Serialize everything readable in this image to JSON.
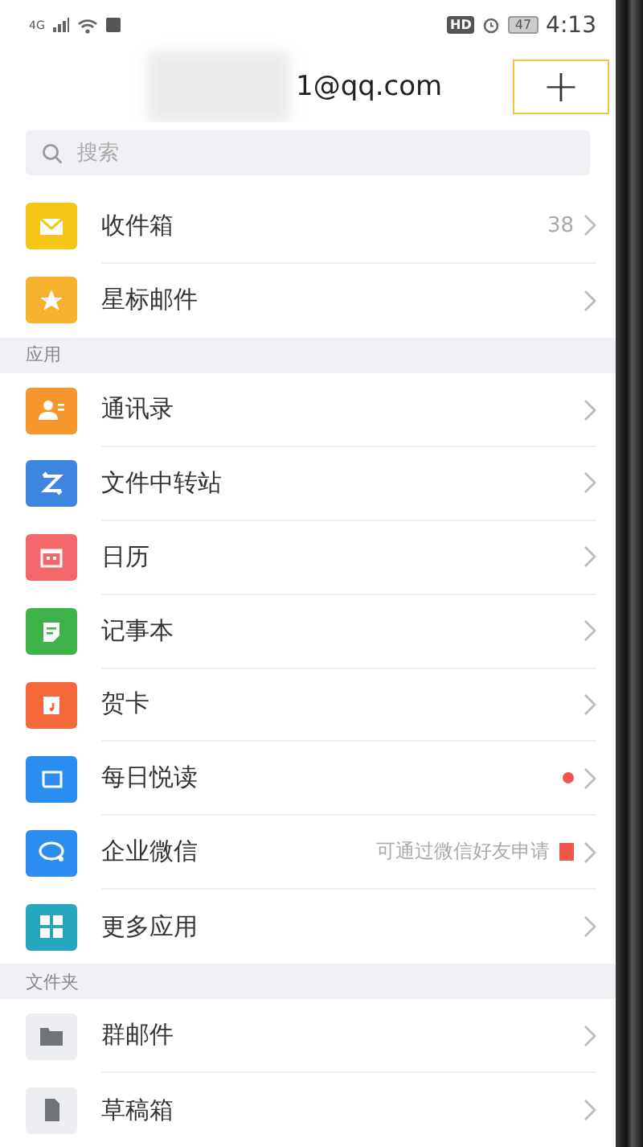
{
  "status_bar": {
    "network": "4G",
    "hd": "HD",
    "battery": "47",
    "time": "4:13"
  },
  "header": {
    "email": "1@qq.com",
    "add_button": "+",
    "highlighted": true
  },
  "search": {
    "placeholder": "搜索"
  },
  "sections": [
    {
      "items": [
        {
          "kind": "mail",
          "color": "#f5c518",
          "label": "收件箱",
          "count": "38"
        },
        {
          "kind": "star",
          "color": "#f8b12c",
          "label": "星标邮件"
        }
      ]
    },
    {
      "title": "应用",
      "items": [
        {
          "kind": "contacts",
          "color": "#f7962f",
          "label": "通讯录"
        },
        {
          "kind": "transfer",
          "color": "#3f86e0",
          "label": "文件中转站"
        },
        {
          "kind": "calendar",
          "color": "#f2676a",
          "label": "日历"
        },
        {
          "kind": "note",
          "color": "#3db34a",
          "label": "记事本"
        },
        {
          "kind": "card",
          "color": "#f4683a",
          "label": "贺卡"
        },
        {
          "kind": "reading",
          "color": "#2a8ef0",
          "label": "每日悦读",
          "dot": true
        },
        {
          "kind": "wework",
          "color": "#2d8cf0",
          "label": "企业微信",
          "hint": "可通过微信好友申请",
          "flag": true
        },
        {
          "kind": "apps",
          "color": "#25a7c0",
          "label": "更多应用"
        }
      ]
    },
    {
      "title": "文件夹",
      "items": [
        {
          "kind": "folder",
          "color": "#eceef2",
          "label": "群邮件"
        },
        {
          "kind": "draft",
          "color": "#eceef2",
          "label": "草稿箱"
        }
      ]
    }
  ]
}
